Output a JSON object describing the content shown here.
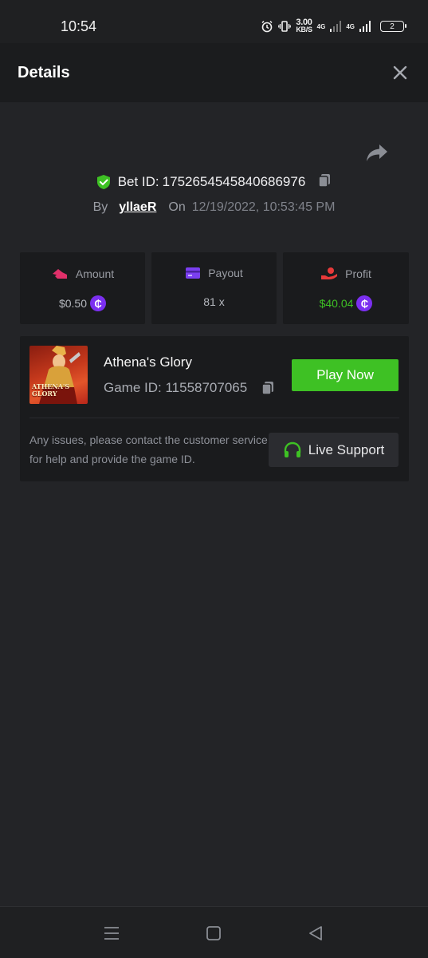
{
  "status_bar": {
    "time": "10:54",
    "speed_value": "3.00",
    "speed_unit": "KB/S",
    "network_1": "4G",
    "network_2": "4G",
    "battery": "2"
  },
  "header": {
    "title": "Details"
  },
  "bet": {
    "label": "Bet ID:",
    "id": "1752654545840686976",
    "by_label": "By",
    "user": "yllaeR",
    "on_label": "On",
    "date": "12/19/2022, 10:53:45 PM"
  },
  "stats": [
    {
      "label": "Amount",
      "value": "$0.50",
      "icon": "amount-icon",
      "color": "#b4b7bd"
    },
    {
      "label": "Payout",
      "value": "81 x",
      "icon": "payout-card-icon",
      "color": "#b4b7bd"
    },
    {
      "label": "Profit",
      "value": "$40.04",
      "icon": "profit-icon",
      "color": "#3ec124"
    }
  ],
  "game": {
    "name": "Athena's Glory",
    "id_label": "Game ID: 11558707065",
    "thumb_text": "ATHENA'S GLORY",
    "play_label": "Play Now",
    "support_text": "Any issues, please contact the customer service for help and provide the game ID.",
    "support_label": "Live Support"
  },
  "colors": {
    "accent_green": "#3ec124",
    "coin_purple": "#7b2ff0",
    "background": "#232427",
    "panel": "#1a1b1d"
  }
}
